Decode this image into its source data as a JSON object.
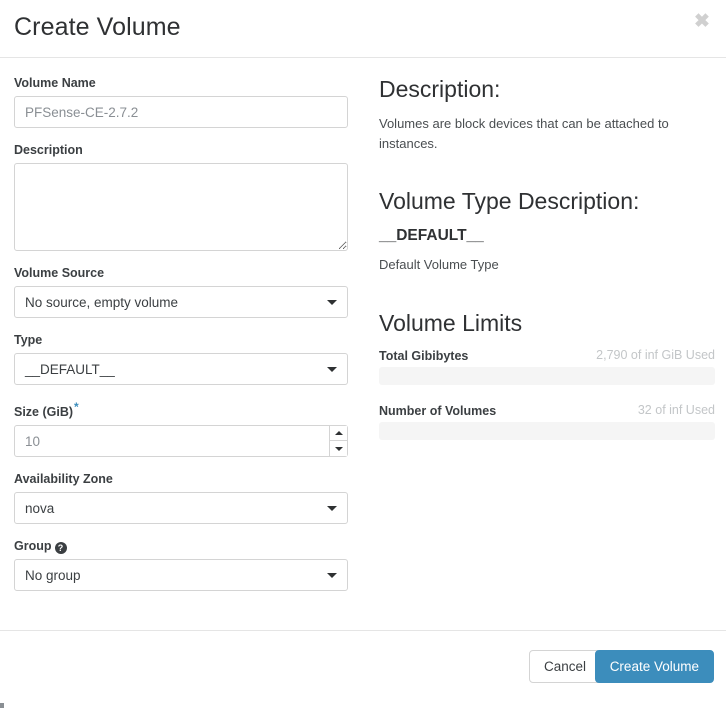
{
  "dialog": {
    "title": "Create Volume",
    "close_icon": "close-icon"
  },
  "form": {
    "volume_name": {
      "label": "Volume Name",
      "value": "PFSense-CE-2.7.2",
      "placeholder": "PFSense-CE-2.7.2"
    },
    "description": {
      "label": "Description",
      "value": "",
      "placeholder": ""
    },
    "volume_source": {
      "label": "Volume Source",
      "selected": "No source, empty volume",
      "caret_icon": "chevron-down-icon"
    },
    "type": {
      "label": "Type",
      "selected": "__DEFAULT__",
      "caret_icon": "chevron-down-icon"
    },
    "size": {
      "label": "Size (GiB)",
      "required_marker": "*",
      "value": "10",
      "placeholder": "10",
      "up_icon": "caret-up-icon",
      "down_icon": "caret-down-icon"
    },
    "availability_zone": {
      "label": "Availability Zone",
      "selected": "nova",
      "caret_icon": "chevron-down-icon"
    },
    "group": {
      "label": "Group",
      "help_icon": "question-mark-icon",
      "help_glyph": "?",
      "selected": "No group",
      "caret_icon": "chevron-down-icon"
    }
  },
  "info": {
    "description_heading": "Description:",
    "description_text": "Volumes are block devices that can be attached to instances.",
    "volume_type_heading": "Volume Type Description:",
    "volume_type_name": "__DEFAULT__",
    "volume_type_desc": "Default Volume Type",
    "limits_heading": "Volume Limits",
    "limits": [
      {
        "label": "Total Gibibytes",
        "value_text": "2,790 of inf GiB Used",
        "used": 2790,
        "total": "inf",
        "percent": 0
      },
      {
        "label": "Number of Volumes",
        "value_text": "32 of inf Used",
        "used": 32,
        "total": "inf",
        "percent": 0
      }
    ]
  },
  "footer": {
    "cancel_label": "Cancel",
    "submit_label": "Create Volume"
  },
  "colors": {
    "accent": "#3c8dbc",
    "border": "#d4d4d4",
    "text": "#3b3f42",
    "muted": "#c3c6c8",
    "track": "#f5f5f5"
  }
}
